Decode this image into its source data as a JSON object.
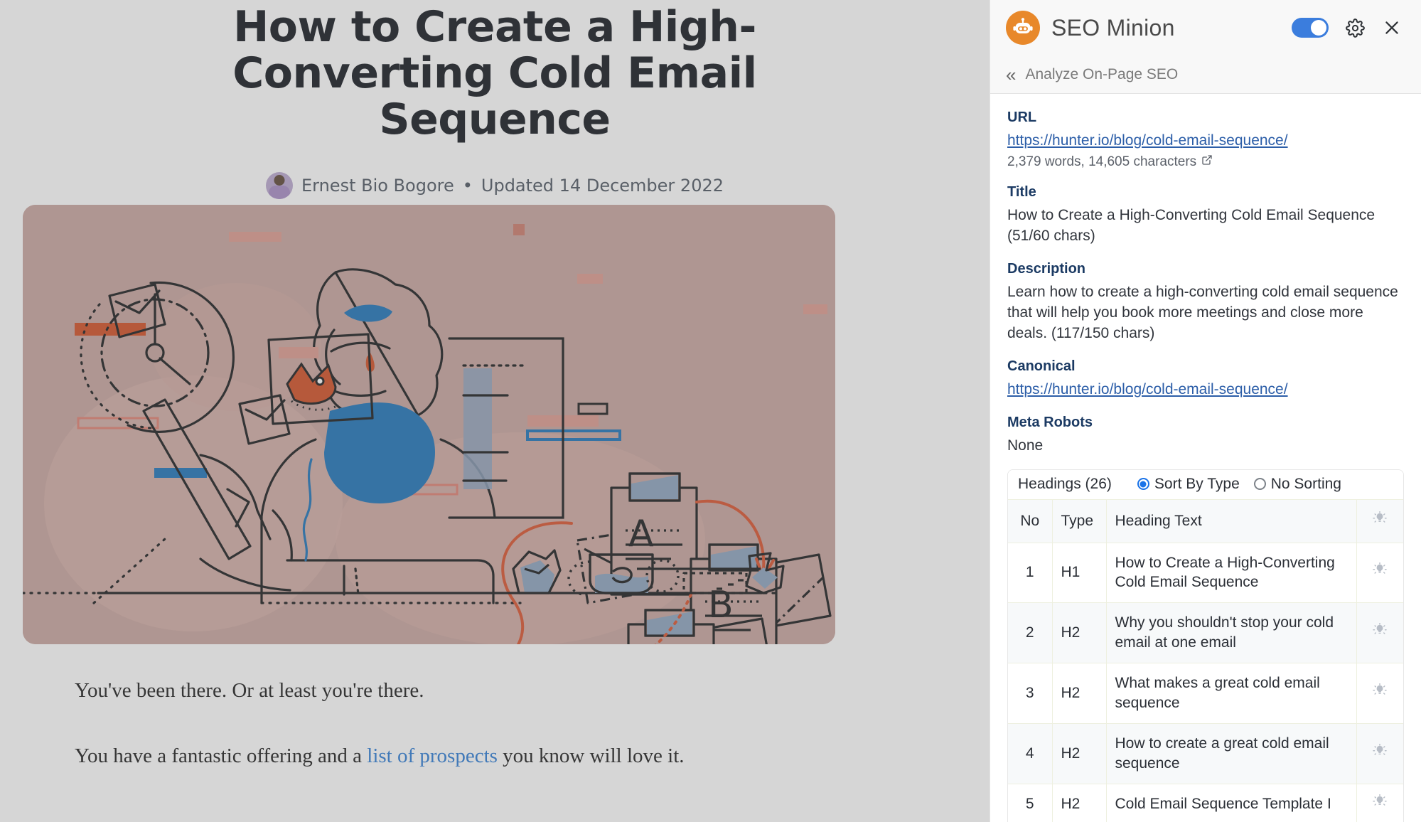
{
  "article": {
    "title": "How to Create a High-Converting Cold Email Sequence",
    "author": "Ernest Bio Bogore",
    "separator": "•",
    "updated": "Updated 14 December 2022",
    "paragraphs": [
      "You've been there. Or at least you're there."
    ],
    "paragraph2_before": "You have a fantastic offering and a ",
    "paragraph2_link": "list of prospects",
    "paragraph2_after": " you know will love it.",
    "hero_alt": "Illustration of a person at a laptop with clock, letters A, B, ceo and flying envelopes"
  },
  "panel": {
    "brand": "SEO Minion",
    "toggle_on": true,
    "breadcrumb": "Analyze On-Page SEO",
    "icons": {
      "logo": "robot-icon",
      "toggle": "enable-toggle",
      "settings": "gear-icon",
      "close": "close-icon",
      "back": "double-chevron-left-icon",
      "external": "external-link-icon",
      "bulb": "lightbulb-icon"
    },
    "fields": {
      "url_label": "URL",
      "url_value": "https://hunter.io/blog/cold-email-sequence/",
      "url_stats": "2,379 words, 14,605 characters",
      "title_label": "Title",
      "title_value": "How to Create a High-Converting Cold Email Sequence (51/60 chars)",
      "description_label": "Description",
      "description_value": "Learn how to create a high-converting cold email sequence that will help you book more meetings and close more deals. (117/150 chars)",
      "canonical_label": "Canonical",
      "canonical_value": "https://hunter.io/blog/cold-email-sequence/",
      "meta_robots_label": "Meta Robots",
      "meta_robots_value": "None"
    },
    "headings": {
      "count_label": "Headings (26)",
      "sort_by_type": "Sort By Type",
      "no_sorting": "No Sorting",
      "selected_sort": "sort_by_type",
      "columns": [
        "No",
        "Type",
        "Heading Text",
        ""
      ],
      "rows": [
        {
          "no": "1",
          "type": "H1",
          "text": "How to Create a High-Converting Cold Email Sequence"
        },
        {
          "no": "2",
          "type": "H2",
          "text": "Why you shouldn't stop your cold email at one email"
        },
        {
          "no": "3",
          "type": "H2",
          "text": "What makes a great cold email sequence"
        },
        {
          "no": "4",
          "type": "H2",
          "text": "How to create a great cold email sequence"
        },
        {
          "no": "5",
          "type": "H2",
          "text": "Cold Email Sequence Template I"
        }
      ]
    }
  },
  "colors": {
    "brand_orange": "#e8882a",
    "toggle_blue": "#3b7ddd",
    "link_blue": "#2c5ea8",
    "label_navy": "#1b3a63",
    "hero_bg": "#c8a49e",
    "accent_red": "#d9512c",
    "accent_blue": "#1a72b8"
  }
}
